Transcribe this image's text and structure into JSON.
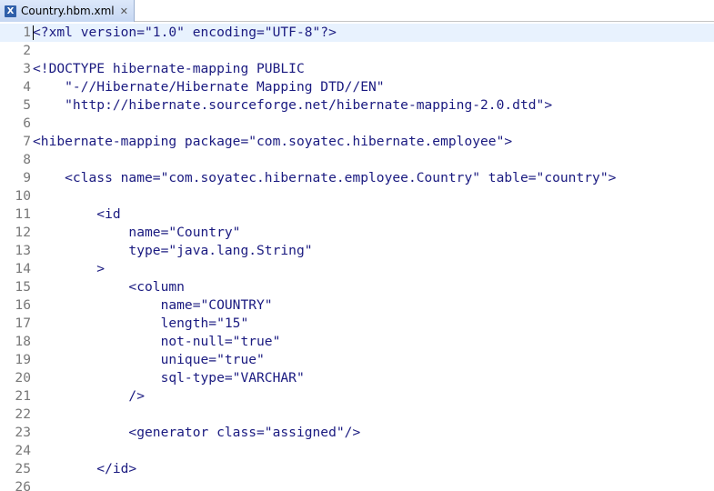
{
  "tab": {
    "title": "Country.hbm.xml",
    "icon": "xml-file-icon"
  },
  "editor": {
    "lines": [
      {
        "num": "1",
        "text": "<?xml version=\"1.0\" encoding=\"UTF-8\"?>"
      },
      {
        "num": "2",
        "text": ""
      },
      {
        "num": "3",
        "text": "<!DOCTYPE hibernate-mapping PUBLIC"
      },
      {
        "num": "4",
        "text": "    \"-//Hibernate/Hibernate Mapping DTD//EN\""
      },
      {
        "num": "5",
        "text": "    \"http://hibernate.sourceforge.net/hibernate-mapping-2.0.dtd\">"
      },
      {
        "num": "6",
        "text": ""
      },
      {
        "num": "7",
        "text": "<hibernate-mapping package=\"com.soyatec.hibernate.employee\">"
      },
      {
        "num": "8",
        "text": ""
      },
      {
        "num": "9",
        "text": "    <class name=\"com.soyatec.hibernate.employee.Country\" table=\"country\">"
      },
      {
        "num": "10",
        "text": ""
      },
      {
        "num": "11",
        "text": "        <id"
      },
      {
        "num": "12",
        "text": "            name=\"Country\""
      },
      {
        "num": "13",
        "text": "            type=\"java.lang.String\""
      },
      {
        "num": "14",
        "text": "        >"
      },
      {
        "num": "15",
        "text": "            <column"
      },
      {
        "num": "16",
        "text": "                name=\"COUNTRY\""
      },
      {
        "num": "17",
        "text": "                length=\"15\""
      },
      {
        "num": "18",
        "text": "                not-null=\"true\""
      },
      {
        "num": "19",
        "text": "                unique=\"true\""
      },
      {
        "num": "20",
        "text": "                sql-type=\"VARCHAR\""
      },
      {
        "num": "21",
        "text": "            />"
      },
      {
        "num": "22",
        "text": ""
      },
      {
        "num": "23",
        "text": "            <generator class=\"assigned\"/>"
      },
      {
        "num": "24",
        "text": ""
      },
      {
        "num": "25",
        "text": "        </id>"
      },
      {
        "num": "26",
        "text": ""
      }
    ]
  }
}
